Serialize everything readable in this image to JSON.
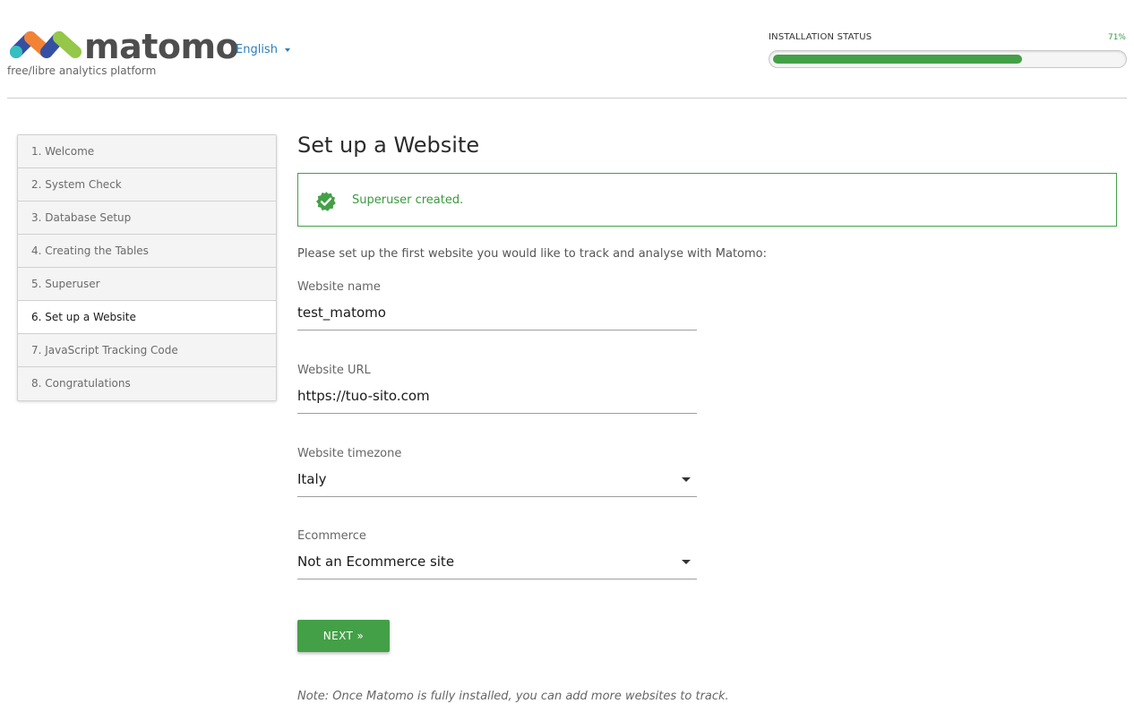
{
  "header": {
    "brand": "matomo",
    "tagline": "free/libre analytics platform",
    "language": "English"
  },
  "status": {
    "label": "INSTALLATION STATUS",
    "percent_text": "71%",
    "percent": 71
  },
  "steps": [
    {
      "label": "1. Welcome"
    },
    {
      "label": "2. System Check"
    },
    {
      "label": "3. Database Setup"
    },
    {
      "label": "4. Creating the Tables"
    },
    {
      "label": "5. Superuser"
    },
    {
      "label": "6. Set up a Website",
      "active": true
    },
    {
      "label": "7. JavaScript Tracking Code"
    },
    {
      "label": "8. Congratulations"
    }
  ],
  "main": {
    "title": "Set up a Website",
    "notice": "Superuser created.",
    "intro": "Please set up the first website you would like to track and analyse with Matomo:",
    "fields": {
      "name": {
        "label": "Website name",
        "value": "test_matomo"
      },
      "url": {
        "label": "Website URL",
        "value": "https://tuo-sito.com"
      },
      "timezone": {
        "label": "Website timezone",
        "value": "Italy"
      },
      "ecommerce": {
        "label": "Ecommerce",
        "value": "Not an Ecommerce site"
      }
    },
    "next_label": "NEXT »",
    "note": "Note: Once Matomo is fully installed, you can add more websites to track."
  },
  "colors": {
    "accent_green": "#43a047",
    "link_blue": "#2a7fbd",
    "logo_blue": "#3450a3",
    "logo_teal": "#35bfc0",
    "logo_orange": "#f38334"
  }
}
